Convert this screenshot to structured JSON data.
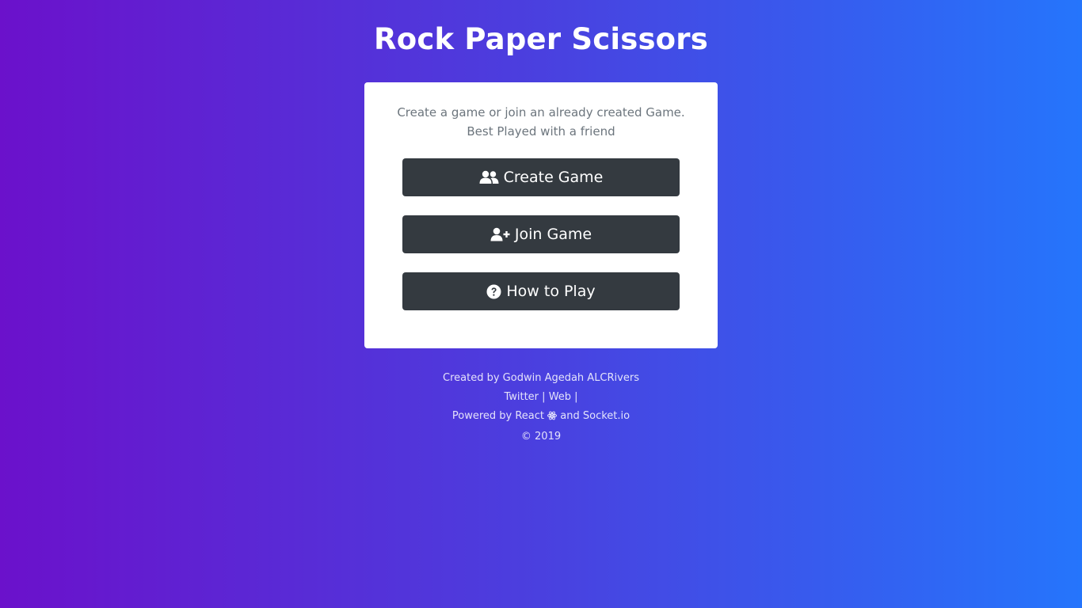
{
  "title": "Rock Paper Scissors",
  "card": {
    "description": "Create a game or join an already created Game. Best Played with a friend",
    "buttons": {
      "create": {
        "label": "Create Game",
        "icon": "users-icon"
      },
      "join": {
        "label": "Join Game",
        "icon": "user-plus-icon"
      },
      "how": {
        "label": "How to Play",
        "icon": "question-circle-icon"
      }
    }
  },
  "footer": {
    "created_by": "Created by Godwin Agedah ALCRivers",
    "links": {
      "twitter": "Twitter",
      "sep1": "|",
      "web": "Web",
      "sep2": "|"
    },
    "powered": {
      "prefix": "Powered by React",
      "icon": "react-icon",
      "suffix": "and Socket.io"
    },
    "copyright": "© 2019"
  },
  "colors": {
    "gradient_start": "#6b11cb",
    "gradient_end": "#2575fc",
    "button_bg": "#343a40",
    "card_text": "#6c757d"
  }
}
